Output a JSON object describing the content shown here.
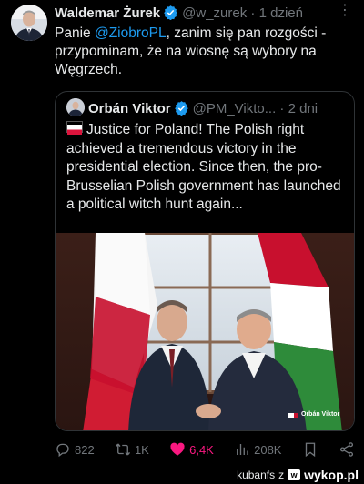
{
  "tweet": {
    "author_name": "Waldemar Żurek",
    "handle": "@w_zurek",
    "separator": "·",
    "time": "1 dzień",
    "text_before": "Panie ",
    "mention": "@ZiobroPL",
    "text_after": ", zanim się pan rozgości - przypominam, że na wiosnę są wybory na Węgrzech."
  },
  "quote": {
    "author_name": "Orbán Viktor",
    "handle": "@PM_Vikto...",
    "separator": "·",
    "time": "2 dni",
    "text": "Justice for Poland! The Polish right achieved a tremendous victory in the presidential election. Since then, the pro-Brusselian Polish government has launched a political witch hunt again...",
    "image_watermark": "Orbán Viktor"
  },
  "actions": {
    "replies": "822",
    "retweets": "1K",
    "likes": "6,4K",
    "views": "208K"
  },
  "footer": {
    "user": "kubanfs",
    "z": "z",
    "brand": "wykop.pl"
  },
  "colors": {
    "background": "#000000",
    "text": "#e7e9ea",
    "muted": "#71767b",
    "link": "#1d9bf0",
    "like": "#f91880",
    "verified": "#1d9bf0"
  }
}
